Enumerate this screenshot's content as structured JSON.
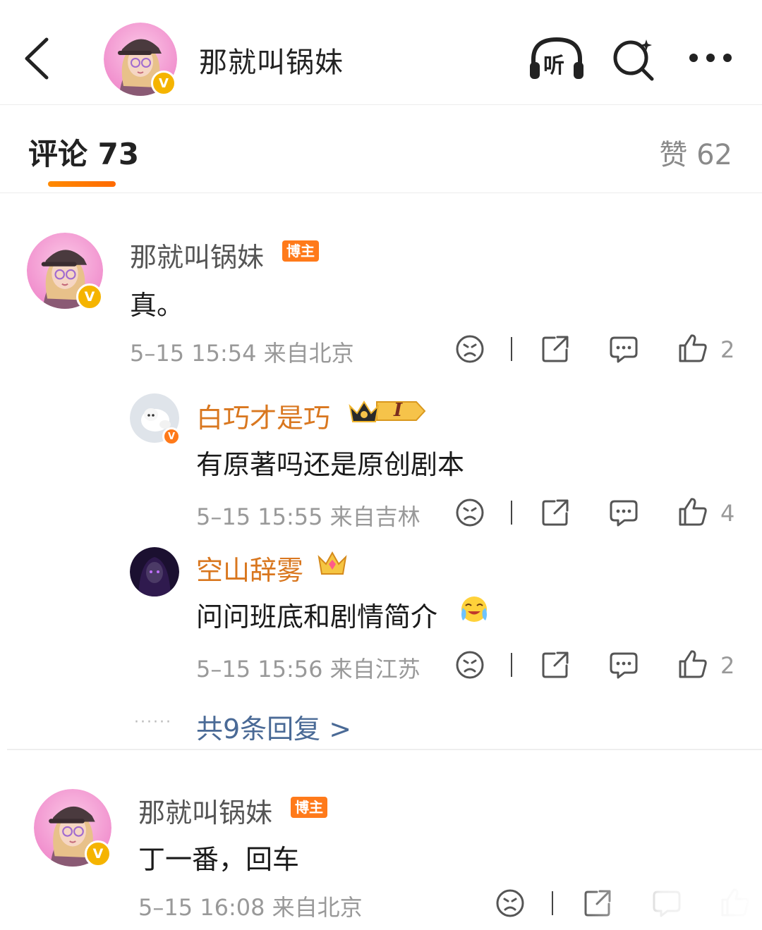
{
  "header": {
    "back_icon": "chevron-left-icon",
    "name": "那就叫锅妹",
    "verified_mark": "V",
    "listen_label": "听",
    "icons": [
      "headphones-listen-icon",
      "search-icon",
      "more-icon"
    ]
  },
  "tabs": {
    "comments_label": "评论 73",
    "likes_label": "赞 62"
  },
  "comments": [
    {
      "user": "那就叫锅妹",
      "badge": "博主",
      "text": "真。",
      "meta": "5–15 15:54  来自北京",
      "like_count": "2",
      "replies": [
        {
          "user": "白巧才是巧",
          "badge_level": "I",
          "text": "有原著吗还是原创剧本",
          "meta": "5–15 15:55  来自吉林",
          "like_count": "4"
        },
        {
          "user": "空山辞雾",
          "text": "问问班底和剧情简介",
          "meta": "5–15 15:56  来自江苏",
          "like_count": "2"
        }
      ],
      "more_replies_dots": "······",
      "more_replies": "共9条回复 >"
    },
    {
      "user": "那就叫锅妹",
      "badge": "博主",
      "text": "丁一番，回车",
      "meta": "5–15 16:08  来自北京"
    }
  ],
  "colors": {
    "accent_orange": "#ff7a1a",
    "username_orange": "#d9771f",
    "link_blue": "#4a6a96",
    "verified_gold": "#f5b400"
  }
}
